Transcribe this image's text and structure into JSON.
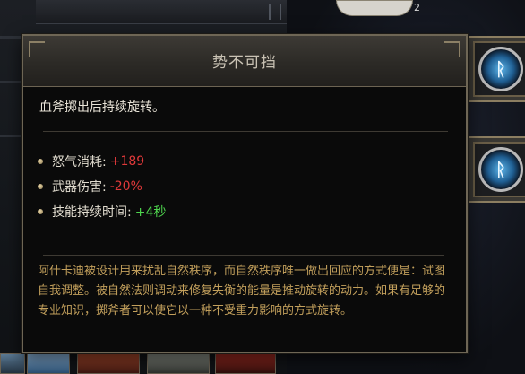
{
  "tooltip": {
    "title": "势不可挡",
    "description": "血斧掷出后持续旋转。",
    "stats": [
      {
        "label": "怒气消耗:",
        "value": "+189",
        "color": "#e0393a"
      },
      {
        "label": "武器伤害:",
        "value": "-20%",
        "color": "#e0393a"
      },
      {
        "label": "技能持续时间:",
        "value": "+4秒",
        "color": "#4ed54e"
      }
    ],
    "lore": "阿什卡迪被设计用来扰乱自然秩序，而自然秩序唯一做出回应的方式便是：试图自我调整。被自然法则调动来修复失衡的能量是推动旋转的动力。如果有足够的专业知识，掷斧者可以使它以一种不受重力影响的方式旋转。"
  },
  "background": {
    "item_count": "2",
    "rune_glyph": "ᚱ"
  }
}
